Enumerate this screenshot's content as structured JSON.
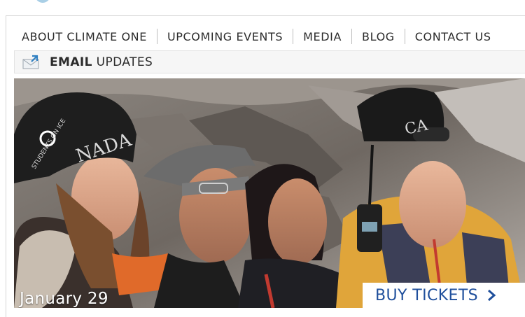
{
  "nav": {
    "items": [
      {
        "label": "ABOUT CLIMATE ONE"
      },
      {
        "label": "UPCOMING EVENTS"
      },
      {
        "label": "MEDIA"
      },
      {
        "label": "BLOG"
      },
      {
        "label": "CONTACT US"
      }
    ]
  },
  "email_updates": {
    "bold": "EMAIL",
    "rest": " UPDATES",
    "icon": "email-envelope-icon"
  },
  "hero": {
    "image_description_icon": "group-photo-image",
    "hat_text_left": "NADA",
    "hat_text_left_small": "STUDENTS ON ICE",
    "hat_text_right": "CA",
    "date": "January 29",
    "buy_label": "BUY TICKETS",
    "buy_icon": "chevron-right-icon"
  },
  "colors": {
    "accent_blue": "#1f4f9c",
    "nav_text": "#2b2b2b"
  }
}
